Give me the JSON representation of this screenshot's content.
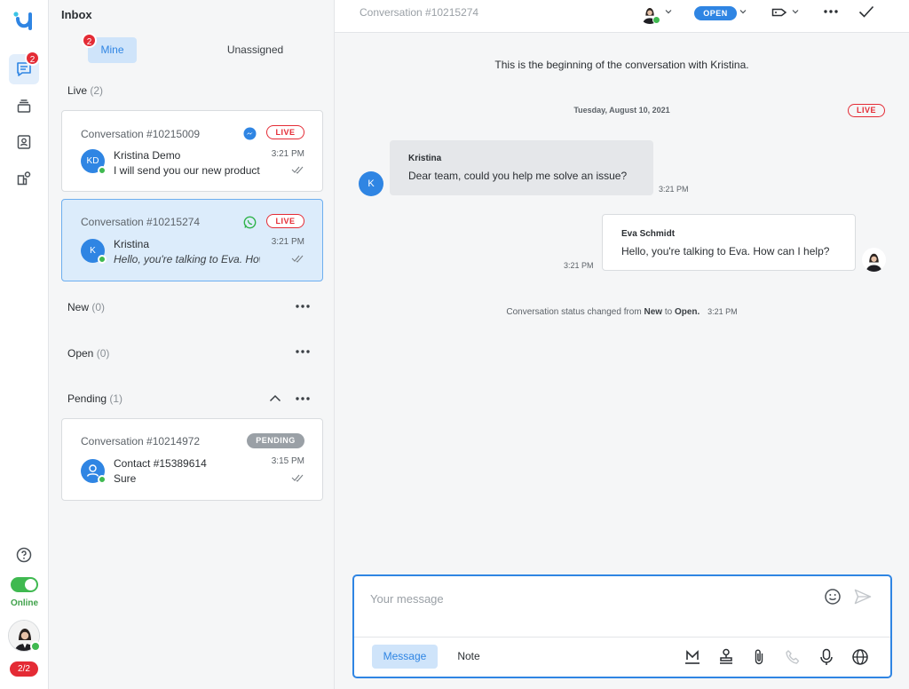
{
  "rail": {
    "chat_badge": "2",
    "status_label": "Online",
    "seat_count": "2/2"
  },
  "inbox": {
    "title": "Inbox",
    "tabs": {
      "mine": "Mine",
      "mine_badge": "2",
      "unassigned": "Unassigned"
    },
    "sections": {
      "live": {
        "label": "Live",
        "count": "(2)"
      },
      "new": {
        "label": "New",
        "count": "(0)"
      },
      "open": {
        "label": "Open",
        "count": "(0)"
      },
      "pending": {
        "label": "Pending",
        "count": "(1)"
      }
    },
    "conversations": [
      {
        "id": "Conversation #10215009",
        "channel": "messenger-icon",
        "status": "LIVE",
        "initials": "KD",
        "name": "Kristina Demo",
        "message": "I will send you our new product",
        "time": "3:21 PM"
      },
      {
        "id": "Conversation #10215274",
        "channel": "whatsapp-icon",
        "status": "LIVE",
        "initials": "K",
        "name": "Kristina",
        "message": "Hello, you're talking to Eva. How can I help?",
        "time": "3:21 PM"
      },
      {
        "id": "Conversation #10214972",
        "status": "PENDING",
        "name": "Contact #15389614",
        "message": "Sure",
        "time": "3:15 PM"
      }
    ]
  },
  "conversation": {
    "title": "Conversation #10215274",
    "status_pill": "OPEN",
    "beginning_text": "This is the beginning of the conversation with Kristina.",
    "date": "Tuesday, August 10, 2021",
    "live_label": "LIVE",
    "messages": [
      {
        "author": "Kristina",
        "initial": "K",
        "text": "Dear team, could you help me solve an issue?",
        "time": "3:21 PM"
      },
      {
        "author": "Eva Schmidt",
        "text": "Hello, you're talking to Eva. How can I help?",
        "time": "3:21 PM"
      }
    ],
    "status_change": {
      "prefix": "Conversation status changed from",
      "from": "New",
      "to_word": "to",
      "to": "Open.",
      "time": "3:21 PM"
    }
  },
  "composer": {
    "placeholder": "Your message",
    "message_tab": "Message",
    "note_tab": "Note"
  },
  "colors": {
    "accent": "#2f85e3",
    "live_red": "#e42b35",
    "online_green": "#3fb950"
  }
}
